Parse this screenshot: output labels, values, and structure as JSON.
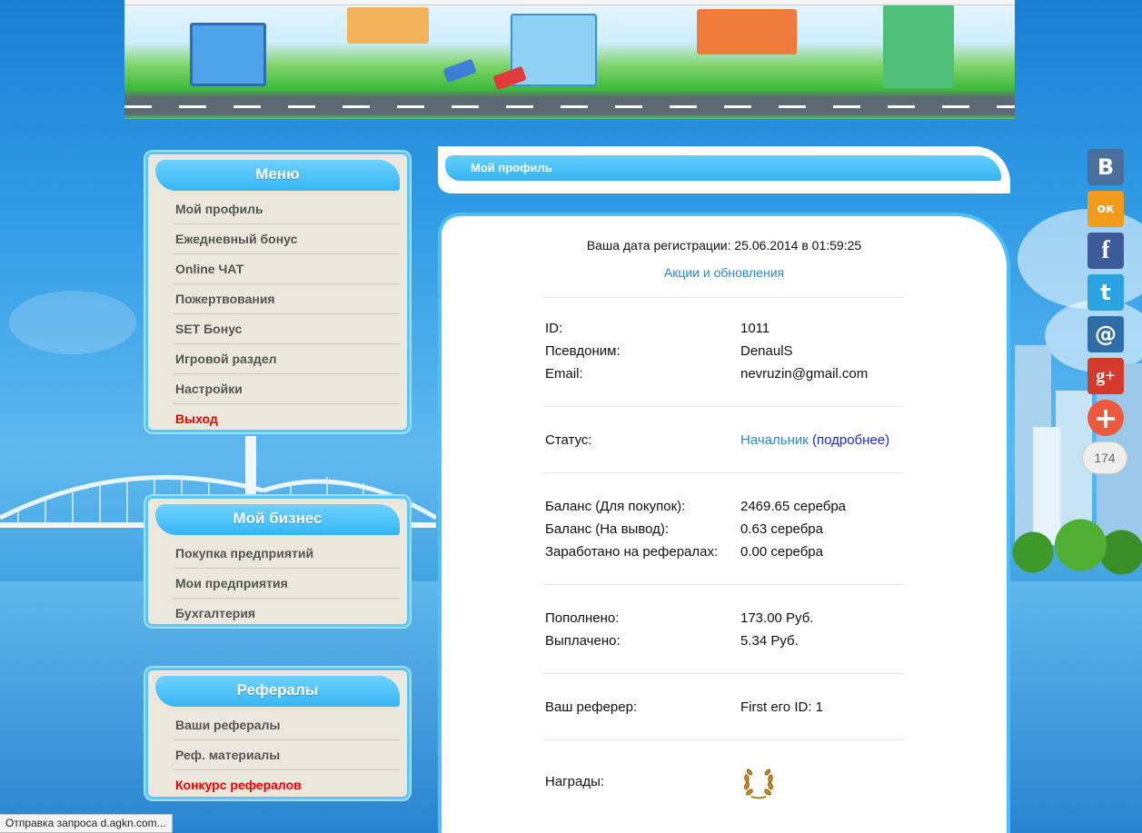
{
  "menu": {
    "title": "Меню",
    "items": [
      {
        "label": "Мой профиль"
      },
      {
        "label": "Ежедневный бонус"
      },
      {
        "label": "Online ЧАТ"
      },
      {
        "label": "Пожертвования"
      },
      {
        "label": "SET Бонус"
      },
      {
        "label": "Игровой раздел"
      },
      {
        "label": "Настройки"
      },
      {
        "label": "Выход"
      }
    ]
  },
  "business": {
    "title": "Мой бизнес",
    "items": [
      {
        "label": "Покупка предприятий"
      },
      {
        "label": "Мои предприятия"
      },
      {
        "label": "Бухгалтерия"
      }
    ]
  },
  "referrals": {
    "title": "Рефералы",
    "items": [
      {
        "label": "Ваши рефералы"
      },
      {
        "label": "Реф. материалы"
      },
      {
        "label": "Конкурс рефералов"
      }
    ]
  },
  "profile": {
    "tab_title": "Мой профиль",
    "registration": "Ваша дата регистрации: 25.06.2014 в 01:59:25",
    "promo_link": "Акции и обновления",
    "id_label": "ID:",
    "id_value": "1011",
    "nick_label": "Псевдоним:",
    "nick_value": "DenaulS",
    "email_label": "Email:",
    "email_value": "nevruzin@gmail.com",
    "status_label": "Статус:",
    "status_value": "Начальник",
    "status_more": "(подробнее)",
    "balance_buy_label": "Баланс (Для покупок):",
    "balance_buy_value": "2469.65 серебра",
    "balance_out_label": "Баланс (На вывод):",
    "balance_out_value": "0.63 серебра",
    "ref_earned_label": "Заработано на рефералах:",
    "ref_earned_value": "0.00 серебра",
    "deposited_label": "Пополнено:",
    "deposited_value": "173.00 Руб.",
    "paid_label": "Выплачено:",
    "paid_value": "5.34 Руб.",
    "referrer_label": "Ваш реферер:",
    "referrer_value": "First его ID: 1",
    "awards_label": "Награды:"
  },
  "share": {
    "vk": "В",
    "ok": "ок",
    "fb": "f",
    "tw": "t",
    "mail": "@",
    "gplus": "g+",
    "more": "+",
    "count": "174"
  },
  "status_bar": "Отправка запроса d.agkn.com...",
  "colors": {
    "accent": "#35b6f5",
    "exit_red": "#e00000",
    "link": "#2a8ad0"
  }
}
